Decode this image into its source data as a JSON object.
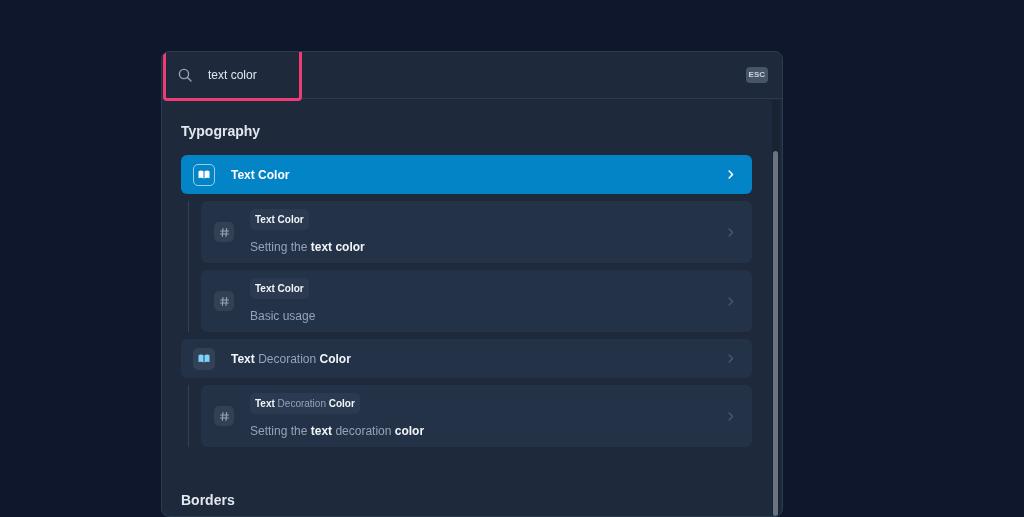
{
  "search": {
    "value": "text color"
  },
  "esc_key": "ESC",
  "sections": [
    {
      "heading": "Typography",
      "results": [
        {
          "title": "Text Color",
          "all_matched": true,
          "selected": true,
          "children": [
            {
              "tag": "Text Color",
              "tag_all_matched": true,
              "text": "Setting the **text color**",
              "selected": false
            },
            {
              "tag": "Text Color",
              "tag_all_matched": true,
              "text": "Basic usage",
              "selected": false
            }
          ]
        },
        {
          "title": "**Text** Decoration **Color**",
          "all_matched": false,
          "selected": false,
          "children": [
            {
              "tag": "**Text** Decoration **Color**",
              "tag_all_matched": false,
              "text": "Setting the **text** decoration **color**",
              "selected": false
            }
          ]
        }
      ]
    },
    {
      "heading": "Borders"
    }
  ]
}
